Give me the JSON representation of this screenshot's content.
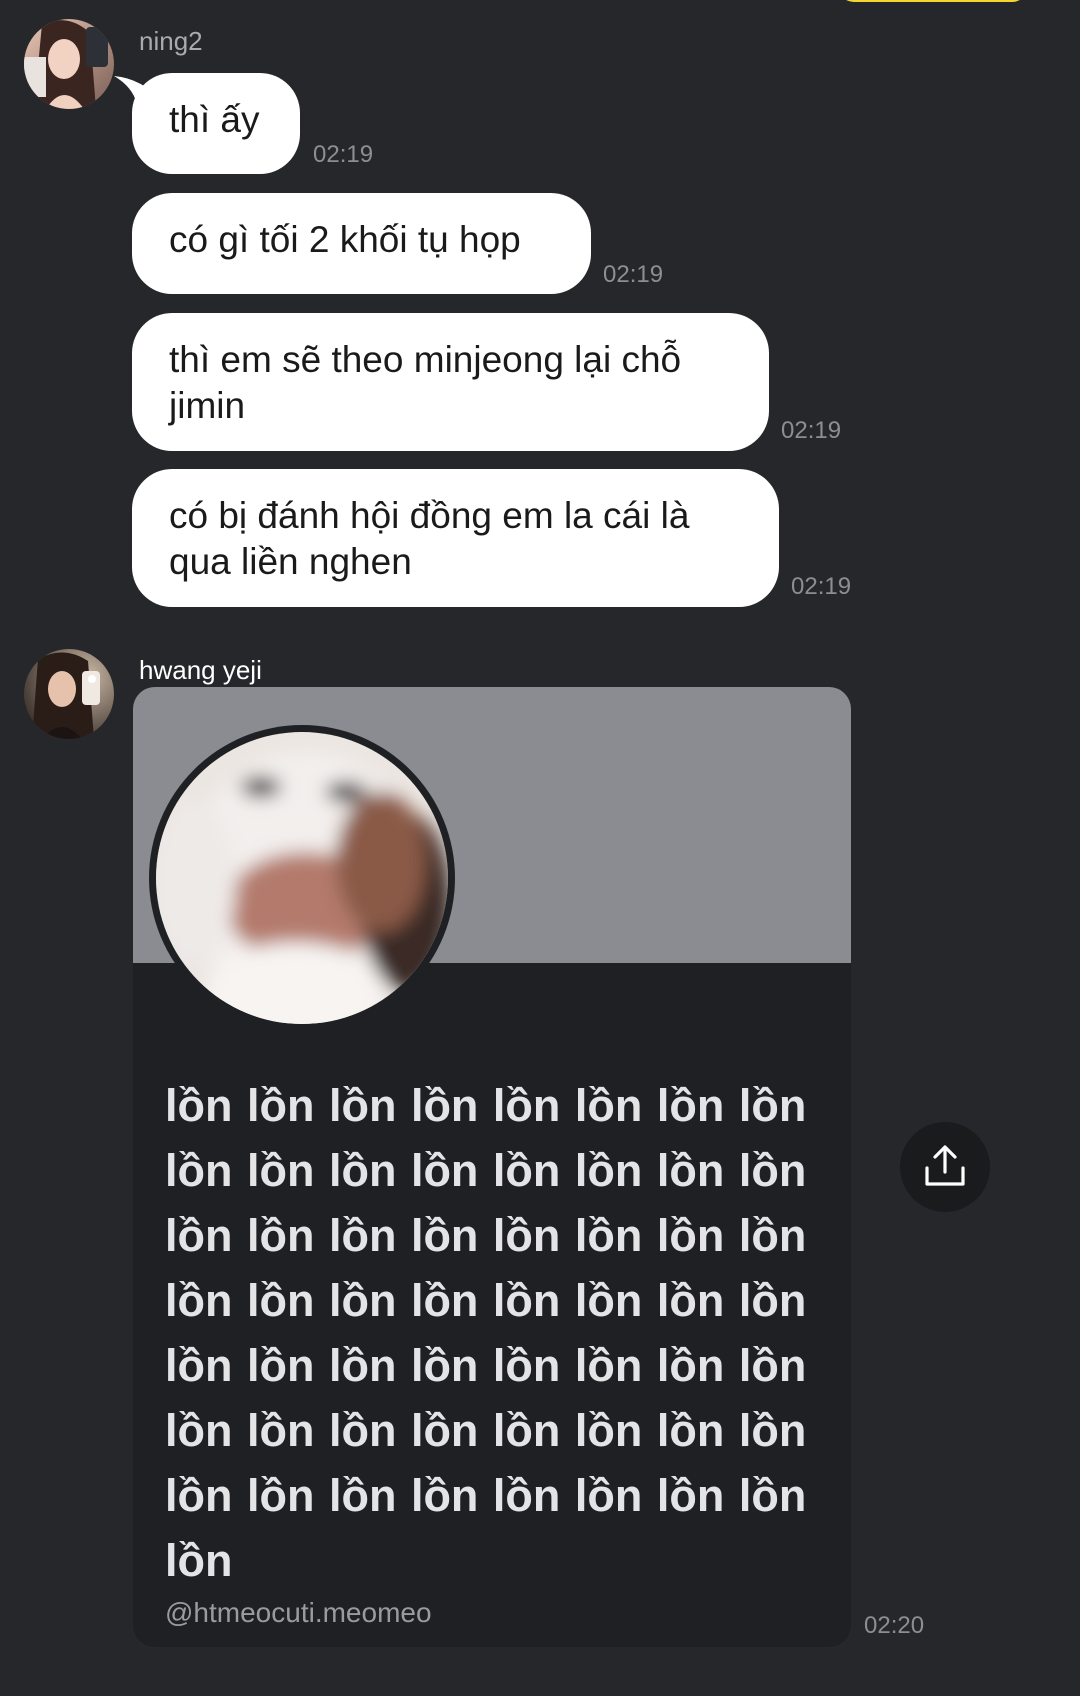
{
  "status_pill": {
    "color": "#f4d531"
  },
  "messages": [
    {
      "sender": "ning2",
      "bubbles": [
        {
          "text": "thì ấy",
          "time": "02:19"
        },
        {
          "text": "có gì tối 2 khối tụ họp",
          "time": "02:19"
        },
        {
          "text": "thì em sẽ theo minjeong lại chỗ jimin",
          "time": "02:19"
        },
        {
          "text": "có bị đánh hội đồng em la cái là qua liền nghen",
          "time": "02:19"
        }
      ]
    },
    {
      "sender": "hwang yeji",
      "shared_post": {
        "text": "lồn lồn lồn lồn lồn lồn lồn lồn lồn lồn lồn lồn lồn lồn lồn lồn lồn lồn lồn lồn lồn lồn lồn lồn lồn lồn lồn lồn lồn lồn lồn lồn lồn lồn lồn lồn lồn lồn lồn lồn lồn lồn lồn lồn lồn lồn lồn lồn lồn lồn lồn lồn lồn lồn lồn lồn lồn",
        "handle": "@htmeocuti.meomeo",
        "time": "02:20"
      },
      "share_icon": "share-upload-icon"
    }
  ],
  "colors": {
    "background": "#26272a",
    "bubble": "#ffffff",
    "card_banner": "#8a8c92",
    "card_body": "#1f2023"
  }
}
